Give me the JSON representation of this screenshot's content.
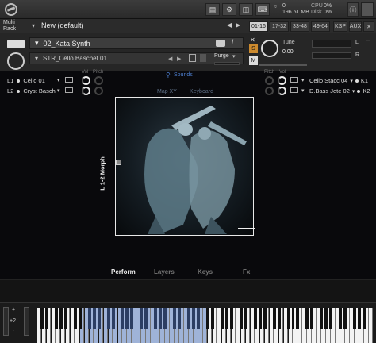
{
  "topbar": {
    "cpu_label": "CPU",
    "cpu_value": "0%",
    "disk_label": "Disk",
    "disk_value": "0%",
    "voices": "0",
    "memory": "196.51 MB",
    "midi_icon": "midi-icon",
    "info_icon": "info-icon"
  },
  "rack": {
    "label_line1": "Multi",
    "label_line2": "Rack",
    "multi_name": "New (default)",
    "ranges": [
      "01-16",
      "17-32",
      "33-48",
      "49-64"
    ],
    "ksp": "KSP",
    "aux": "AUX"
  },
  "instrument": {
    "name": "02_Kata Synth",
    "snapshot": "STR_Cello Baschet 01",
    "purge_label": "Purge",
    "tune_label": "Tune",
    "tune_value": "0.00",
    "solo": "S",
    "mute": "M",
    "aux_l": "L",
    "aux_r": "R"
  },
  "main": {
    "sounds_label": "Sounds",
    "mapxy_label": "Map XY",
    "keyboard_label": "Keyboard",
    "vol_label": "Vol",
    "pitch_label": "Pitch",
    "morph_label": "L 1-2 Morph",
    "layers_left": [
      {
        "id": "L1",
        "name": "Cello 01"
      },
      {
        "id": "L2",
        "name": "Cryst Basch"
      }
    ],
    "layers_right": [
      {
        "id": "K1",
        "name": "Cello Stacc 04"
      },
      {
        "id": "K2",
        "name": "D.Bass Jete 02"
      }
    ],
    "tabs": [
      "Perform",
      "Layers",
      "Keys",
      "Fx"
    ]
  },
  "keyboard": {
    "octave_up": "+",
    "octave_value": "+2",
    "octave_down": "-"
  }
}
